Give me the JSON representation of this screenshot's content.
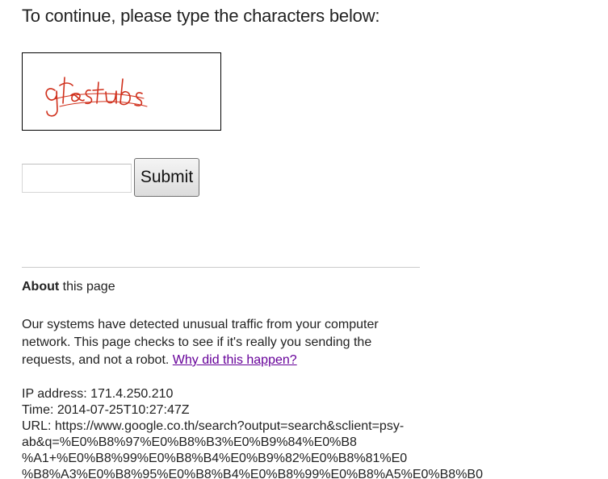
{
  "heading": "To continue, please type the characters below:",
  "captcha": {
    "text": "gfestubs",
    "ink_color": "#d0301c"
  },
  "form": {
    "input_value": "",
    "submit_label": "Submit"
  },
  "about": {
    "title_bold": "About",
    "title_rest": " this page",
    "paragraph": "Our systems have detected unusual traffic from your computer network. This page checks to see if it's really you sending the requests, and not a robot. ",
    "link_label": "Why did this happen?",
    "link_color": "#660099"
  },
  "details": {
    "ip_line": "IP address: 171.4.250.210",
    "time_line": "Time: 2014-07-25T10:27:47Z",
    "url_line_1": "URL: https://www.google.co.th/search?output=search&sclient=psy-",
    "url_line_2": "ab&q=%E0%B8%97%E0%B8%B3%E0%B9%84%E0%B8",
    "url_line_3": "%A1+%E0%B8%99%E0%B8%B4%E0%B9%82%E0%B8%81%E0",
    "url_line_4": "%B8%A3%E0%B8%95%E0%B8%B4%E0%B8%99%E0%B8%A5%E0%B8%B0"
  }
}
